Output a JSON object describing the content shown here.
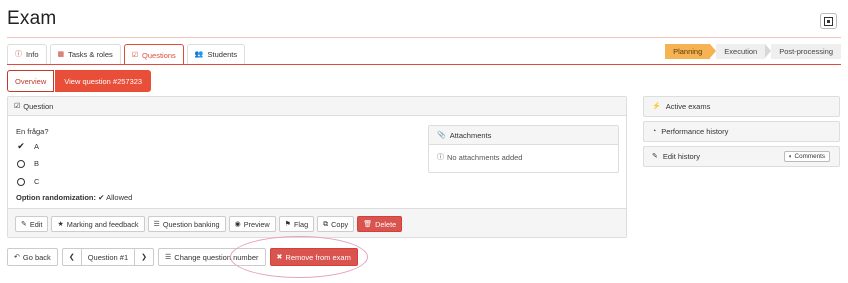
{
  "header": {
    "title": "Exam"
  },
  "tabs": [
    {
      "label": "Info",
      "icon": "info-circle-icon"
    },
    {
      "label": "Tasks & roles",
      "icon": "table-icon"
    },
    {
      "label": "Questions",
      "icon": "checkbox-icon",
      "active": true
    },
    {
      "label": "Students",
      "icon": "users-icon"
    }
  ],
  "workflow": {
    "steps": [
      "Planning",
      "Execution",
      "Post-processing"
    ],
    "active": "Planning"
  },
  "subtabs": {
    "overview": "Overview",
    "view_question": "View question #257323"
  },
  "question": {
    "panel_title": "Question",
    "prompt": "En fråga?",
    "options": [
      {
        "label": "A",
        "correct": true
      },
      {
        "label": "B",
        "correct": false
      },
      {
        "label": "C",
        "correct": false
      }
    ],
    "randomization_label": "Option randomization:",
    "randomization_value": "Allowed",
    "attachments_title": "Attachments",
    "attachments_empty": "No attachments added"
  },
  "actions": {
    "edit": "Edit",
    "marking": "Marking and feedback",
    "banking": "Question banking",
    "preview": "Preview",
    "flag": "Flag",
    "copy": "Copy",
    "delete": "Delete"
  },
  "bottom": {
    "go_back": "Go back",
    "question_label": "Question #1",
    "change_number": "Change question number",
    "remove": "Remove from exam"
  },
  "sidebar": {
    "active_exams": "Active exams",
    "performance_history": "Performance history",
    "edit_history": "Edit history",
    "comments": "Comments"
  },
  "colors": {
    "accent": "#e94e38",
    "danger": "#d9534f",
    "planning": "#f6b353",
    "highlight_circle": "#e8a0c0"
  }
}
